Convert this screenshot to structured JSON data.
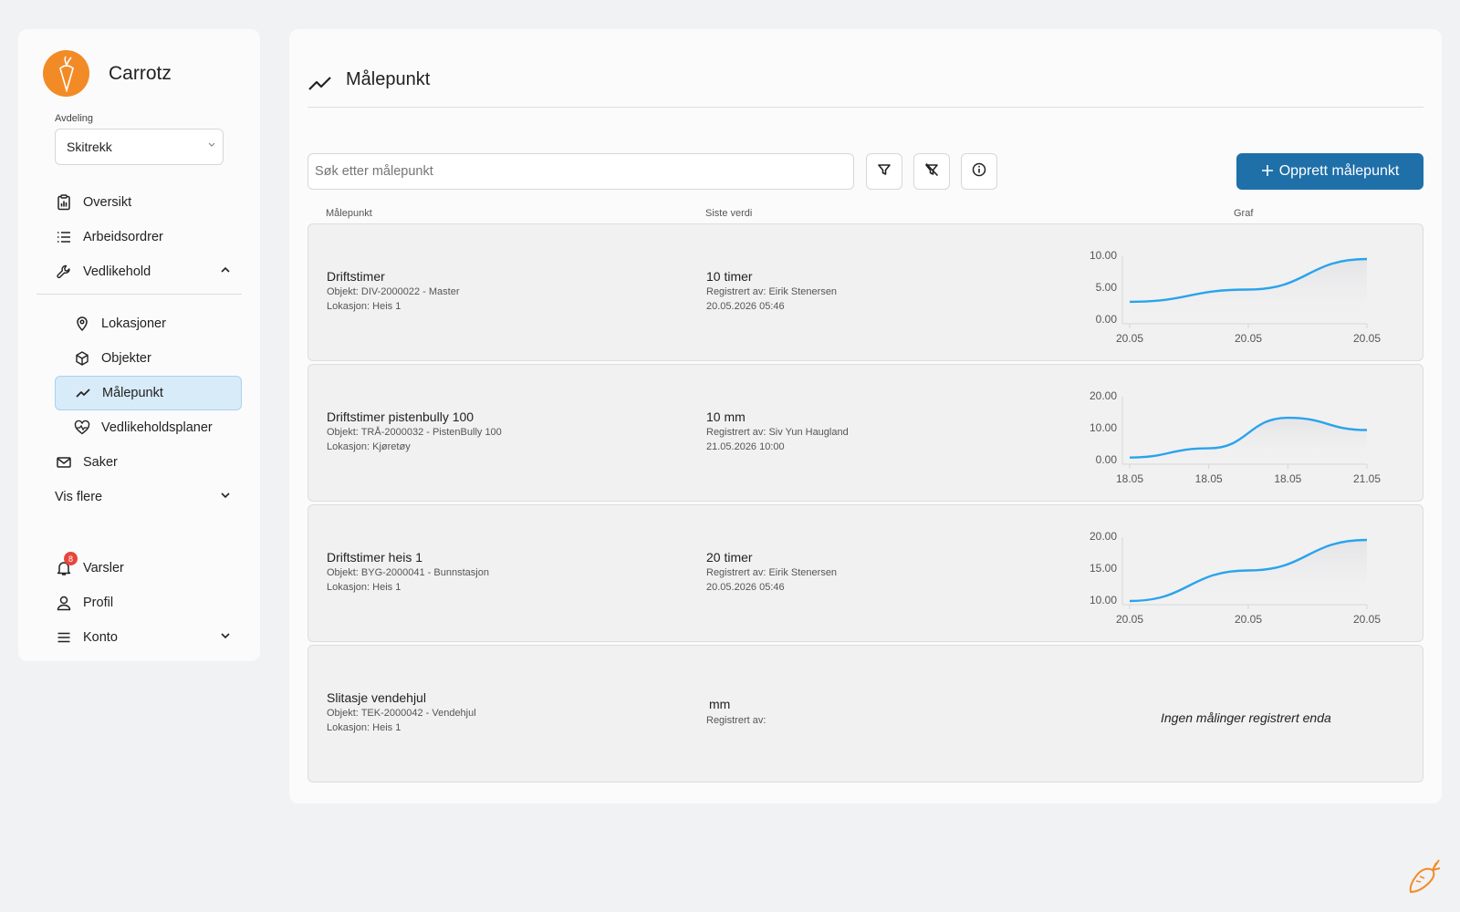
{
  "app": {
    "name": "Carrotz"
  },
  "sidebar": {
    "department_label": "Avdeling",
    "department_value": "Skitrekk",
    "items": [
      {
        "label": "Oversikt",
        "icon": "clipboard-chart-icon"
      },
      {
        "label": "Arbeidsordrer",
        "icon": "list-icon"
      },
      {
        "label": "Vedlikehold",
        "icon": "wrench-icon",
        "expanded": true
      },
      {
        "label": "Lokasjoner",
        "icon": "map-pin-icon"
      },
      {
        "label": "Objekter",
        "icon": "cube-icon"
      },
      {
        "label": "Målepunkt",
        "icon": "trend-line-icon",
        "active": true
      },
      {
        "label": "Vedlikeholdsplaner",
        "icon": "heart-pulse-icon"
      },
      {
        "label": "Saker",
        "icon": "mail-icon"
      },
      {
        "label": "Vis flere",
        "icon": ""
      }
    ],
    "bottom": {
      "alerts_label": "Varsler",
      "alerts_count": "8",
      "profile_label": "Profil",
      "account_label": "Konto"
    }
  },
  "page": {
    "title": "Målepunkt",
    "search_placeholder": "Søk etter målepunkt",
    "create_label": "Opprett målepunkt",
    "columns": {
      "name": "Målepunkt",
      "latest": "Siste verdi",
      "graph": "Graf"
    }
  },
  "rows": [
    {
      "name": "Driftstimer",
      "object": "Objekt: DIV-2000022 - Master",
      "location": "Lokasjon: Heis 1",
      "value": "10 timer",
      "registered_by": "Registrert av: Eirik  Stenersen",
      "date": "20.05.2026 05:46"
    },
    {
      "name": "Driftstimer pistenbully 100",
      "object": "Objekt: TRÅ-2000032 - PistenBully 100",
      "location": "Lokasjon: Kjøretøy",
      "value": "10 mm",
      "registered_by": "Registrert av: Siv Yun Haugland",
      "date": "21.05.2026 10:00"
    },
    {
      "name": "Driftstimer heis 1",
      "object": "Objekt: BYG-2000041 - Bunnstasjon",
      "location": "Lokasjon: Heis 1",
      "value": "20 timer",
      "registered_by": "Registrert av: Eirik  Stenersen",
      "date": "20.05.2026 05:46"
    },
    {
      "name": "Slitasje vendehjul",
      "object": "Objekt: TEK-2000042 - Vendehjul",
      "location": "Lokasjon: Heis 1",
      "value": " mm",
      "registered_by": "Registrert av:",
      "no_data": "Ingen målinger registrert enda"
    }
  ],
  "chart_data": [
    {
      "type": "line",
      "x": [
        "20.05",
        "20.05",
        "20.05"
      ],
      "values": [
        3,
        5,
        10
      ],
      "yticks": [
        "10.00",
        "5.00",
        "0.00"
      ],
      "ylim": [
        0,
        10
      ],
      "color": "#2aa3ec"
    },
    {
      "type": "line",
      "x": [
        "18.05",
        "18.05",
        "18.05",
        "21.05"
      ],
      "values": [
        1,
        4,
        14,
        10
      ],
      "yticks": [
        "20.00",
        "10.00",
        "0.00"
      ],
      "ylim": [
        0,
        20
      ],
      "color": "#2aa3ec"
    },
    {
      "type": "line",
      "x": [
        "20.05",
        "20.05",
        "20.05"
      ],
      "values": [
        10,
        15,
        20
      ],
      "yticks": [
        "20.00",
        "15.00",
        "10.00"
      ],
      "ylim": [
        10,
        20
      ],
      "color": "#2aa3ec"
    }
  ]
}
